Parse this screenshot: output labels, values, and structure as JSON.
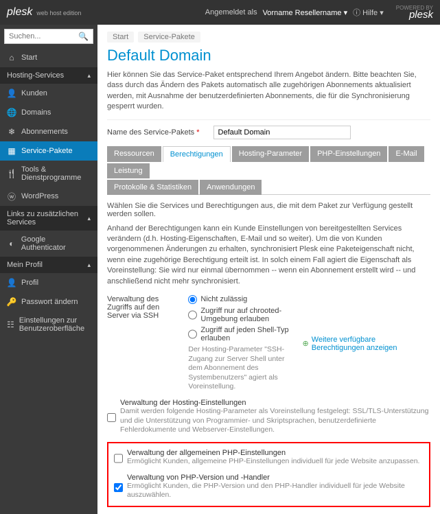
{
  "topbar": {
    "brand": "plesk",
    "brand_sub": "web host edition",
    "logged_in": "Angemeldet als",
    "user": "Vorname Resellername",
    "help": "Hilfe",
    "powered": "POWERED BY",
    "powered_brand": "plesk"
  },
  "search": {
    "placeholder": "Suchen..."
  },
  "sidebar": {
    "start": "Start",
    "header1": "Hosting-Services",
    "kunden": "Kunden",
    "domains": "Domains",
    "abos": "Abonnements",
    "pakete": "Service-Pakete",
    "tools": "Tools & Dienstprogramme",
    "wordpress": "WordPress",
    "header2": "Links zu zusätzlichen Services",
    "google": "Google Authenticator",
    "header3": "Mein Profil",
    "profil": "Profil",
    "passwort": "Passwort ändern",
    "ui": "Einstellungen zur Benutzeroberfläche"
  },
  "breadcrumb": {
    "start": "Start",
    "pakete": "Service-Pakete"
  },
  "page": {
    "title": "Default Domain",
    "intro": "Hier können Sie das Service-Paket entsprechend Ihrem Angebot ändern. Bitte beachten Sie, dass durch das Ändern des Pakets automatisch alle zugehörigen Abonnements aktualisiert werden, mit Ausnahme der benutzerdefinierten Abonnements, die für die Synchronisierung gesperrt wurden.",
    "name_label": "Name des Service-Pakets",
    "name_value": "Default Domain"
  },
  "tabs": {
    "ressourcen": "Ressourcen",
    "berechtigungen": "Berechtigungen",
    "hosting": "Hosting-Parameter",
    "php": "PHP-Einstellungen",
    "email": "E-Mail",
    "leistung": "Leistung",
    "protokolle": "Protokolle & Statistiken",
    "anwendungen": "Anwendungen"
  },
  "content": {
    "desc1": "Wählen Sie die Services und Berechtigungen aus, die mit dem Paket zur Verfügung gestellt werden sollen.",
    "desc2": "Anhand der Berechtigungen kann ein Kunde Einstellungen von bereitgestellten Services verändern (d.h. Hosting-Eigenschaften, E-Mail und so weiter). Um die von Kunden vorgenommenen Änderungen zu erhalten, synchronisiert Plesk eine Paketeigenschaft nicht, wenn eine zugehörige Berechtigung erteilt ist. In solch einem Fall agiert die Eigenschaft als Voreinstellung: Sie wird nur einmal übernommen -- wenn ein Abonnement erstellt wird -- und anschließend nicht mehr synchronisiert.",
    "ssh_label": "Verwaltung des Zugriffs auf den Server via SSH",
    "ssh_opt1": "Nicht zulässig",
    "ssh_opt2": "Zugriff nur auf chrooted-Umgebung erlauben",
    "ssh_opt3": "Zugriff auf jeden Shell-Typ erlauben",
    "ssh_note": "Der Hosting-Parameter \"SSH-Zugang zur Server Shell unter dem Abonnement des Systembenutzers\" agiert als Voreinstellung.",
    "more": "Weitere verfügbare Berechtigungen anzeigen",
    "hosting_title": "Verwaltung der Hosting-Einstellungen",
    "hosting_sub": "Damit werden folgende Hosting-Parameter als Voreinstellung festgelegt: SSL/TLS-Unterstützung und die Unterstützung von Programmier- und Skriptsprachen, benutzerdefinierte Fehlerdokumente und Webserver-Einstellungen.",
    "php_general_title": "Verwaltung der allgemeinen PHP-Einstellungen",
    "php_general_sub": "Ermöglicht Kunden, allgemeine PHP-Einstellungen individuell für jede Website anzupassen.",
    "php_handler_title": "Verwaltung von PHP-Version und -Handler",
    "php_handler_sub": "Ermöglicht Kunden, die PHP-Version und den PHP-Handler individuell für jede Website auszuwählen."
  }
}
